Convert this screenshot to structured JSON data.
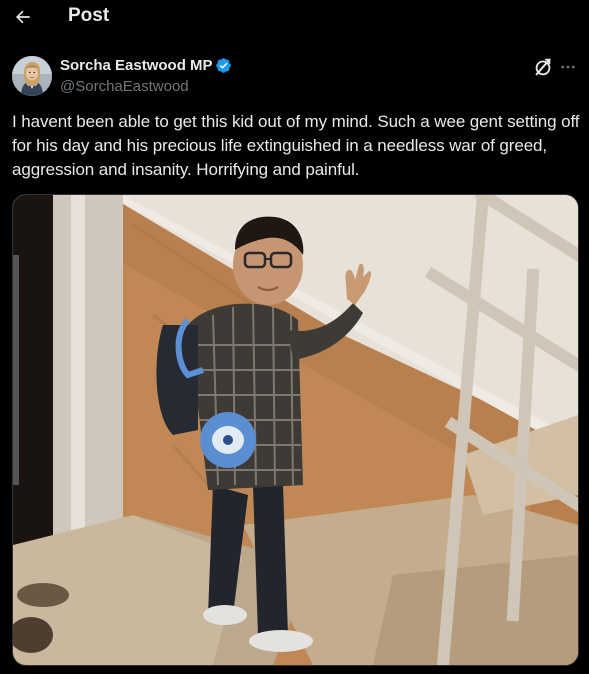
{
  "header": {
    "title": "Post",
    "back_icon": "arrow-left-icon"
  },
  "author": {
    "display_name": "Sorcha Eastwood MP",
    "handle": "@SorchaEastwood",
    "verified": true,
    "verified_color": "#1d9bf0"
  },
  "tweet": {
    "text": "I havent been able to get this kid out of my mind. Such a wee gent setting off for his day and his precious life extinguished in a needless war of greed, aggression and insanity. Horrifying and painful."
  },
  "actions": {
    "grok_icon": "grok-icon",
    "more_icon": "more-horizontal-icon"
  },
  "colors": {
    "background": "#000000",
    "text": "#e7e9ea",
    "secondary_text": "#71767b",
    "border": "#2f3336"
  }
}
